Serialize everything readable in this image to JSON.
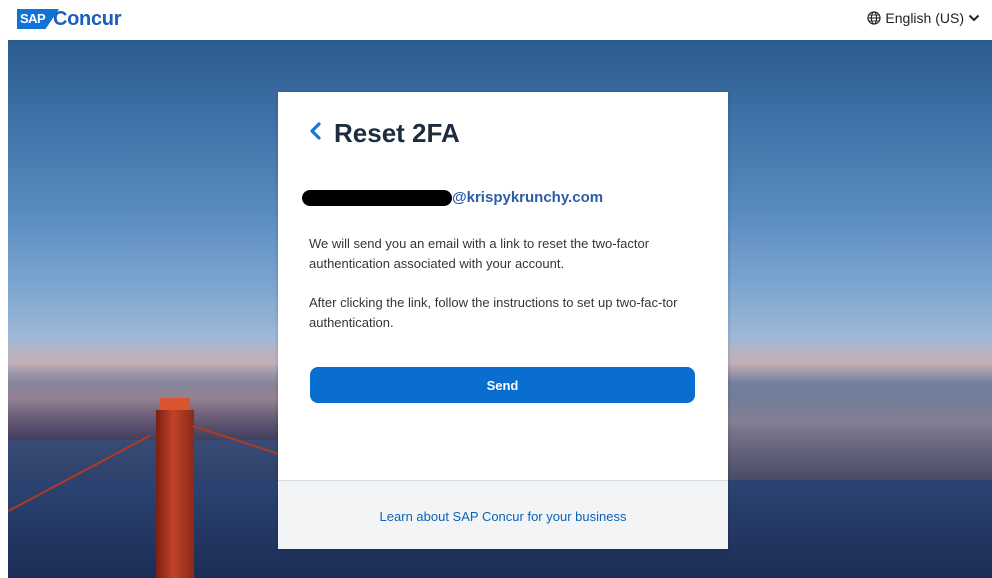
{
  "header": {
    "logo_mark": "SAP",
    "logo_text": "Concur",
    "language_label": "English (US)"
  },
  "card": {
    "title": "Reset 2FA",
    "email_domain": "@krispykrunchy.com",
    "paragraph_1": "We will send you an email with a link to reset the two-factor authentication associated with your account.",
    "paragraph_2": "After clicking the link, follow the instructions to set up two-fac-tor authentication.",
    "send_label": "Send",
    "footer_link": "Learn about SAP Concur for your business"
  },
  "colors": {
    "brand_blue": "#0a6ed1",
    "link_blue": "#0b63b7",
    "title_text": "#1d2d3e"
  },
  "icons": {
    "language": "globe-icon",
    "language_caret": "chevron-down-icon",
    "back": "chevron-left-icon"
  }
}
